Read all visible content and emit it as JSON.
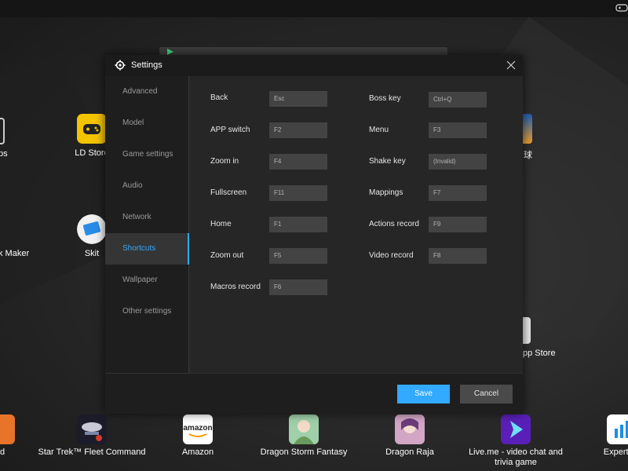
{
  "colors": {
    "accent": "#32aaff",
    "dialog_bg": "#262626",
    "sidebar_bg": "#1e1e1e",
    "field_bg": "#434343"
  },
  "desktop": {
    "left_cut_labels": [
      "ps",
      "k Maker"
    ],
    "items": [
      {
        "label": "LD Store",
        "icon": "ld-store-icon"
      },
      {
        "label": "Skit",
        "icon": "skit-icon"
      }
    ],
    "right_cut_labels": [
      "球",
      "pp Store"
    ],
    "bottom": [
      {
        "label": "od",
        "icon": "app-icon"
      },
      {
        "label": "Star Trek™ Fleet Command",
        "icon": "star-trek-icon"
      },
      {
        "label": "Amazon",
        "icon": "amazon-icon"
      },
      {
        "label": "Dragon Storm Fantasy",
        "icon": "dragon-storm-icon"
      },
      {
        "label": "Dragon Raja",
        "icon": "dragon-raja-icon"
      },
      {
        "label": "Live.me - video chat and trivia game",
        "icon": "liveme-icon"
      },
      {
        "label": "ExpertOp",
        "icon": "expertop-icon"
      }
    ]
  },
  "dialog": {
    "title": "Settings",
    "nav": [
      "Advanced",
      "Model",
      "Game settings",
      "Audio",
      "Network",
      "Shortcuts",
      "Wallpaper",
      "Other settings"
    ],
    "active_nav": "Shortcuts",
    "shortcuts_left": [
      {
        "label": "Back",
        "value": "Esc"
      },
      {
        "label": "APP switch",
        "value": "F2"
      },
      {
        "label": "Zoom in",
        "value": "F4"
      },
      {
        "label": "Fullscreen",
        "value": "F11"
      },
      {
        "label": "Home",
        "value": "F1"
      },
      {
        "label": "Zoom out",
        "value": "F5"
      },
      {
        "label": "Macros record",
        "value": "F6"
      }
    ],
    "shortcuts_right": [
      {
        "label": "Boss key",
        "value": "Ctrl+Q"
      },
      {
        "label": "Menu",
        "value": "F3"
      },
      {
        "label": "Shake key",
        "value": "(Invalid)"
      },
      {
        "label": "Mappings",
        "value": "F7"
      },
      {
        "label": "Actions record",
        "value": "F9"
      },
      {
        "label": "Video record",
        "value": "F8"
      }
    ],
    "save_label": "Save",
    "cancel_label": "Cancel"
  }
}
